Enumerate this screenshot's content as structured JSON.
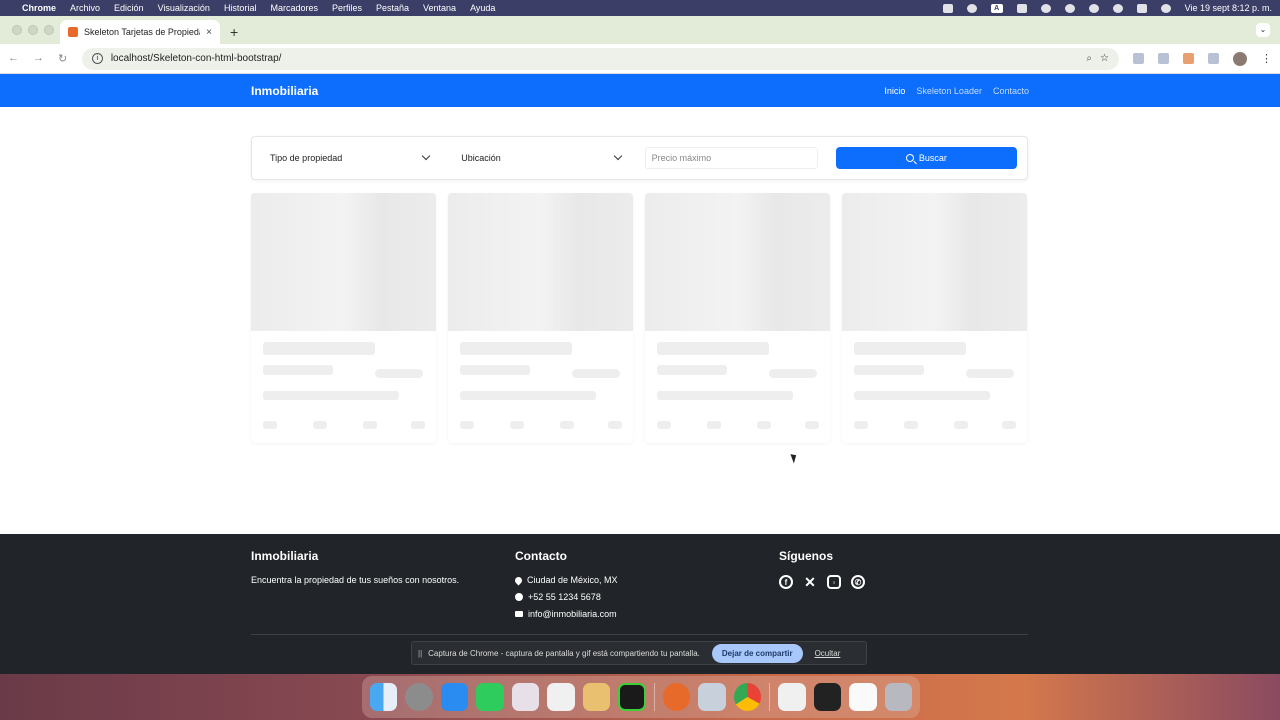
{
  "menubar": {
    "items": [
      "Chrome",
      "Archivo",
      "Edición",
      "Visualización",
      "Historial",
      "Marcadores",
      "Perfiles",
      "Pestaña",
      "Ventana",
      "Ayuda"
    ],
    "datetime": "Vie 19 sept 8:12 p. m.",
    "badge": "A"
  },
  "browser": {
    "tab_title": "Skeleton Tarjetas de Propiedades",
    "tab_close": "×",
    "new_tab": "+",
    "url": "localhost/Skeleton-con-html-bootstrap/"
  },
  "site": {
    "brand": "Inmobiliaria",
    "nav": [
      {
        "label": "Inicio",
        "active": true
      },
      {
        "label": "Skeleton Loader",
        "active": false
      },
      {
        "label": "Contacto",
        "active": false
      }
    ]
  },
  "search": {
    "type_select": "Tipo de propiedad",
    "location_select": "Ubicación",
    "price_placeholder": "Precio máximo",
    "button_label": "Buscar"
  },
  "footer": {
    "col1_title": "Inmobiliaria",
    "col1_text": "Encuentra la propiedad de tus sueños con nosotros.",
    "col2_title": "Contacto",
    "address": "Ciudad de México, MX",
    "phone": "+52 55 1234 5678",
    "email": "info@inmobiliaria.com",
    "col3_title": "Síguenos"
  },
  "share_bar": {
    "pause": "||",
    "text": "Captura de Chrome - captura de pantalla y gif está compartiendo tu pantalla.",
    "stop_label": "Dejar de compartir",
    "hide_label": "Ocultar"
  }
}
